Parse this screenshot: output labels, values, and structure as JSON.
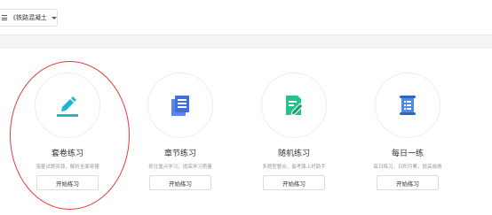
{
  "header": {
    "course_select": {
      "label": "《铁路混凝土",
      "icon": "menu-icon"
    }
  },
  "cards": [
    {
      "title": "套卷练习",
      "desc": "海量试题资源，解析全面易懂",
      "button": "开始练习",
      "icon": "edit-pen-icon",
      "color": "#1fb6d6"
    },
    {
      "title": "章节练习",
      "desc": "抓住重点学习，提高学习质量",
      "button": "开始练习",
      "icon": "book-icon",
      "color": "#3f6fd9"
    },
    {
      "title": "随机练习",
      "desc": "多题型整合，备考路上好助手",
      "button": "开始练习",
      "icon": "edit-document-icon",
      "color": "#27c18e"
    },
    {
      "title": "每日一练",
      "desc": "每日练习，日积月累，提高成绩",
      "button": "开始练习",
      "icon": "scroll-list-icon",
      "color": "#3a76d8"
    }
  ],
  "annotation": {
    "color": "#e23a3a",
    "shape": "ellipse"
  }
}
